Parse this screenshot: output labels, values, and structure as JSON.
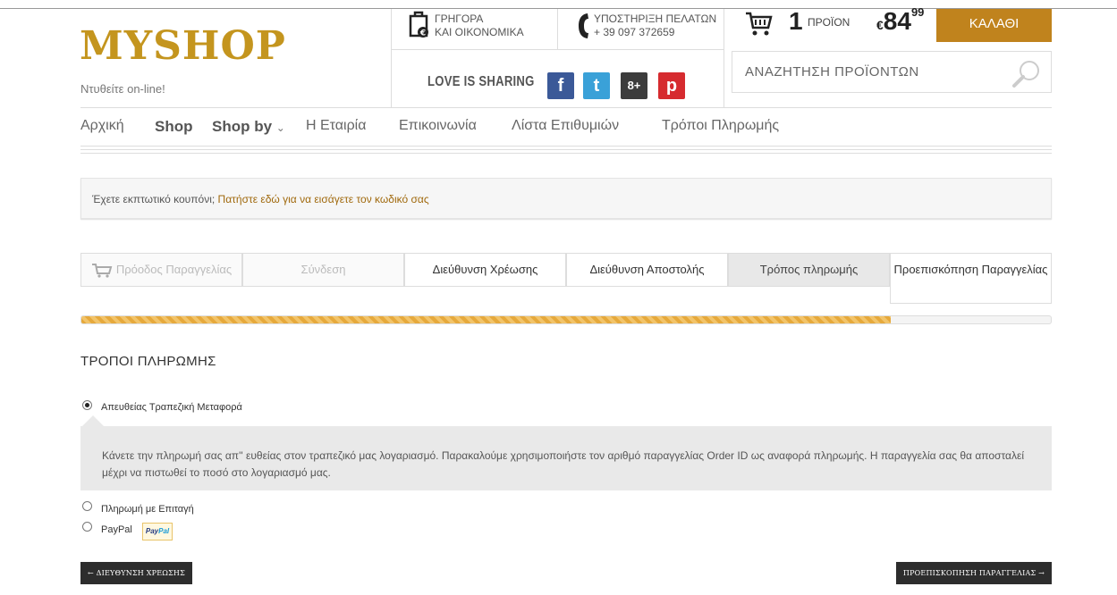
{
  "header": {
    "logo": "MYSHOP",
    "tagline": "Ντυθείτε on-line!",
    "shipping": {
      "line1": "ΓΡΗΓΟΡΑ",
      "line2": "ΚΑΙ ΟΙΚΟΝΟΜΙΚΑ"
    },
    "support": {
      "line1": "ΥΠΟΣΤΗΡΙΞΗ ΠΕΛΑΤΩΝ",
      "line2": "+ 39 097 372659"
    },
    "share_label": "LOVE IS SHARING",
    "social": {
      "facebook": "f",
      "twitter": "t",
      "googleplus": "8+",
      "pinterest": "p"
    },
    "cart": {
      "count": "1",
      "unit": "ΠΡΟΪΟΝ",
      "currency": "€",
      "price_main": "84",
      "price_cents": "99",
      "button": "ΚΑΛΑΘΙ"
    },
    "search": {
      "placeholder": "ΑΝΑΖΗΤΗΣΗ ΠΡΟΪΟΝΤΩΝ"
    }
  },
  "nav": {
    "items": [
      {
        "label": "Αρχική"
      },
      {
        "label": "Shop"
      },
      {
        "label": "Shop by"
      },
      {
        "label": "Η Εταιρία"
      },
      {
        "label": "Επικοινωνία"
      },
      {
        "label": "Λίστα Επιθυμιών"
      },
      {
        "label": "Τρόποι Πληρωμής"
      }
    ],
    "dropdown_arrow": "⌄"
  },
  "coupon": {
    "text": "Έχετε εκπτωτικό κουπόνι;",
    "link": "Πατήστε εδώ για να εισάγετε τον κωδικό σας"
  },
  "steps": [
    {
      "label": "Πρόοδος Παραγγελίας",
      "state": "disabled"
    },
    {
      "label": "Σύνδεση",
      "state": "disabled"
    },
    {
      "label": "Διεύθυνση Χρέωσης",
      "state": "normal"
    },
    {
      "label": "Διεύθυνση Αποστολής",
      "state": "normal"
    },
    {
      "label": "Τρόπος πληρωμής",
      "state": "active"
    },
    {
      "label": "Προεπισκόπηση Παραγγελίας",
      "state": "current"
    }
  ],
  "progress": 0.835,
  "payment": {
    "title": "ΤΡΟΠΟΙ ΠΛΗΡΩΜΗΣ",
    "options": [
      {
        "label": "Απευθείας Τραπεζική Μεταφορά",
        "checked": true
      },
      {
        "label": "Πληρωμή με Επιταγή",
        "checked": false
      },
      {
        "label": "PayPal",
        "checked": false
      }
    ],
    "description": "Κάνετε την πληρωμή σας απ'' ευθείας στον τραπεζικό μας λογαριασμό. Παρακαλούμε χρησιμοποιήστε τον αριθμό παραγγελίας Order ID ως αναφορά πληρωμής. Η παραγγελία σας θα αποσταλεί μέχρι να πιστωθεί το ποσό στο λογαριασμό μας.",
    "paypal_badge": {
      "part1": "Pay",
      "part2": "Pal"
    }
  },
  "buttons": {
    "back": "← ΔΙΕΥΘΥΝΣΗ ΧΡΕΩΣΗΣ",
    "next": "ΠΡΟΕΠΙΣΚΟΠΗΣΗ ΠΑΡΑΓΓΕΛΙΑΣ →"
  },
  "colors": {
    "accent": "#c0831d",
    "logo": "#c4951e",
    "link": "#a0690d",
    "dark_button": "#2d2d2d"
  }
}
